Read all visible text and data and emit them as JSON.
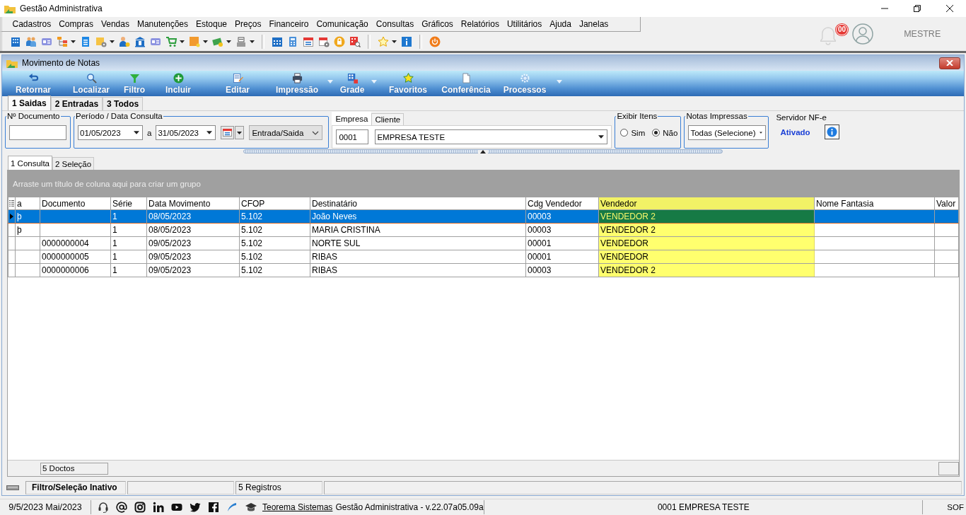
{
  "window": {
    "title": "Gestão Administrativa"
  },
  "menu": [
    "Cadastros",
    "Compras",
    "Vendas",
    "Manutenções",
    "Estoque",
    "Preços",
    "Financeiro",
    "Comunicação",
    "Consultas",
    "Gráficos",
    "Relatórios",
    "Utilitários",
    "Ajuda",
    "Janelas"
  ],
  "notifications": {
    "badge": "00"
  },
  "user": {
    "name": "MESTRE"
  },
  "document_window": {
    "title": "Movimento de Notas"
  },
  "ribbon": [
    {
      "label": "Retornar",
      "dropdown": false
    },
    {
      "label": "Localizar",
      "dropdown": false
    },
    {
      "label": "Filtro",
      "dropdown": false
    },
    {
      "label": "Incluir",
      "dropdown": false
    },
    {
      "label": "Editar",
      "dropdown": false
    },
    {
      "label": "Impressão",
      "dropdown": true
    },
    {
      "label": "Grade",
      "dropdown": true
    },
    {
      "label": "Favoritos",
      "dropdown": false
    },
    {
      "label": "Conferência",
      "dropdown": false
    },
    {
      "label": "Processos",
      "dropdown": true
    }
  ],
  "tabs": [
    {
      "label": "1 Saidas",
      "selected": true
    },
    {
      "label": "2 Entradas",
      "selected": false
    },
    {
      "label": "3 Todos",
      "selected": false
    }
  ],
  "filters": {
    "documento": {
      "label": "Nº Documento"
    },
    "periodo": {
      "label": "Período / Data Consulta",
      "from": "01/05/2023",
      "separator": "a",
      "to": "31/05/2023",
      "direction": "Entrada/Saida"
    },
    "empresa": {
      "tabs": [
        {
          "label": "Empresa",
          "selected": true
        },
        {
          "label": "Cliente",
          "selected": false
        }
      ],
      "code": "0001",
      "name": "EMPRESA TESTE"
    },
    "exibir_itens": {
      "label": "Exibir Itens",
      "options": [
        {
          "label": "Sim",
          "selected": false
        },
        {
          "label": "Não",
          "selected": true
        }
      ]
    },
    "notas_impressas": {
      "label": "Notas Impressas",
      "value": "Todas (Selecione)"
    },
    "servidor_nfe": {
      "label": "Servidor NF-e",
      "status": "Ativado"
    }
  },
  "view_tabs": [
    {
      "label": "1 Consulta",
      "selected": true
    },
    {
      "label": "2 Seleção",
      "selected": false
    }
  ],
  "grid": {
    "group_hint": "Arraste um título de coluna aqui para criar um grupo",
    "columns": [
      {
        "label": "a",
        "highlighted": false
      },
      {
        "label": "Documento",
        "highlighted": false
      },
      {
        "label": "Série",
        "highlighted": false
      },
      {
        "label": "Data Movimento",
        "highlighted": false
      },
      {
        "label": "CFOP",
        "highlighted": false
      },
      {
        "label": "Destinatário",
        "highlighted": false
      },
      {
        "label": "Cdg Vendedor",
        "highlighted": false
      },
      {
        "label": "Vendedor",
        "highlighted": true
      },
      {
        "label": "Nome Fantasia",
        "highlighted": false
      },
      {
        "label": "Valor",
        "highlighted": false
      }
    ],
    "rows": [
      {
        "selected": true,
        "column_1": "þ",
        "serie": "1",
        "data_movimento": "08/05/2023",
        "cfop": "5.102",
        "destinatario": "João Neves",
        "cdg_vendedor": "00003",
        "vendedor": "VENDEDOR 2"
      },
      {
        "selected": false,
        "column_1": "þ",
        "serie": "1",
        "data_movimento": "08/05/2023",
        "cfop": "5.102",
        "destinatario": "MARIA CRISTINA",
        "cdg_vendedor": "00003",
        "vendedor": "VENDEDOR 2"
      },
      {
        "selected": false,
        "documento": "0000000004",
        "serie": "1",
        "data_movimento": "09/05/2023",
        "cfop": "5.102",
        "destinatario": "NORTE SUL",
        "cdg_vendedor": "00001",
        "vendedor": "VENDEDOR"
      },
      {
        "selected": false,
        "documento": "0000000005",
        "serie": "1",
        "data_movimento": "09/05/2023",
        "cfop": "5.102",
        "destinatario": "RIBAS",
        "cdg_vendedor": "00001",
        "vendedor": "VENDEDOR"
      },
      {
        "selected": false,
        "documento": "0000000006",
        "serie": "1",
        "data_movimento": "09/05/2023",
        "cfop": "5.102",
        "destinatario": "RIBAS",
        "cdg_vendedor": "00003",
        "vendedor": "VENDEDOR 2"
      }
    ],
    "footer": {
      "count": "5 Doctos"
    }
  },
  "status_bar": {
    "filter": "Filtro/Seleção Inativo",
    "records": "5 Registros"
  },
  "app_status_bar": {
    "date": "9/5/2023 Mai/2023",
    "link": "Teorema Sistemas",
    "version": "Gestão Administrativa - v.22.07a05.09a",
    "company": "0001 EMPRESA TESTE",
    "user": "SOF"
  }
}
